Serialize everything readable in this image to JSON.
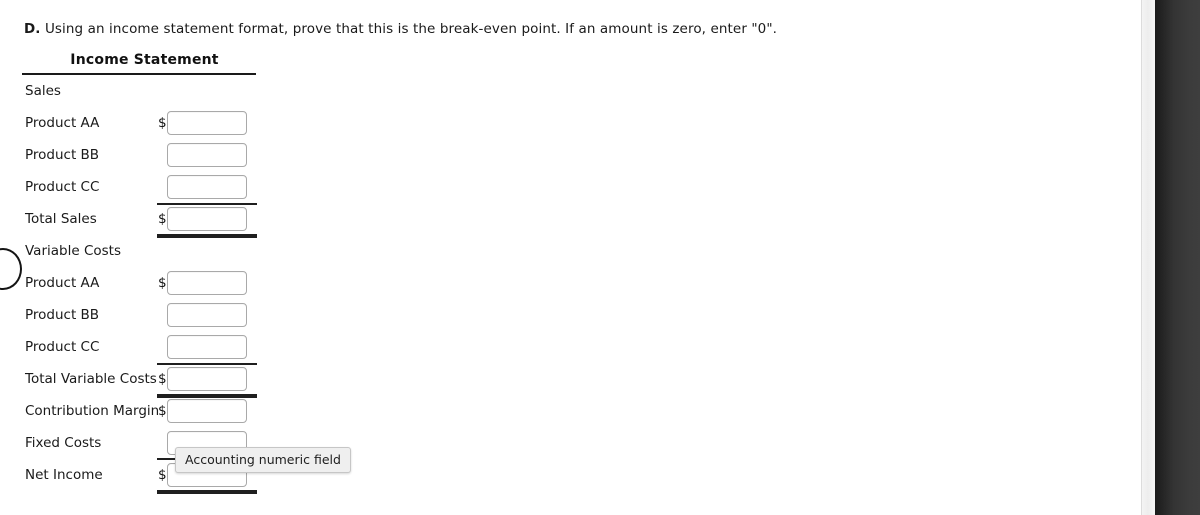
{
  "instruction": {
    "lead": "D.",
    "text": " Using an income statement format, prove that this is the break-even point. If an amount is zero, enter \"0\"."
  },
  "statement": {
    "title": "Income Statement",
    "currency_symbol": "$",
    "rows": [
      {
        "label": "Sales",
        "type": "section",
        "money": "",
        "value": "",
        "rule_top": false,
        "rule_bottom": "none"
      },
      {
        "label": "Product AA",
        "type": "input",
        "money": "$",
        "value": "",
        "rule_top": false,
        "rule_bottom": "none"
      },
      {
        "label": "Product BB",
        "type": "input",
        "money": "",
        "value": "",
        "rule_top": false,
        "rule_bottom": "none"
      },
      {
        "label": "Product CC",
        "type": "input",
        "money": "",
        "value": "",
        "rule_top": false,
        "rule_bottom": "none"
      },
      {
        "label": "Total Sales",
        "type": "input",
        "money": "$",
        "value": "",
        "rule_top": true,
        "rule_bottom": "double"
      },
      {
        "label": "Variable Costs",
        "type": "section",
        "money": "",
        "value": "",
        "rule_top": false,
        "rule_bottom": "none"
      },
      {
        "label": "Product AA",
        "type": "input",
        "money": "$",
        "value": "",
        "rule_top": false,
        "rule_bottom": "none"
      },
      {
        "label": "Product BB",
        "type": "input",
        "money": "",
        "value": "",
        "rule_top": false,
        "rule_bottom": "none"
      },
      {
        "label": "Product CC",
        "type": "input",
        "money": "",
        "value": "",
        "rule_top": false,
        "rule_bottom": "none"
      },
      {
        "label": "Total Variable Costs",
        "type": "input",
        "money": "$",
        "value": "",
        "rule_top": true,
        "rule_bottom": "double"
      },
      {
        "label": "Contribution Margin",
        "type": "input",
        "money": "$",
        "value": "",
        "rule_top": false,
        "rule_bottom": "none"
      },
      {
        "label": "Fixed Costs",
        "type": "input",
        "money": "",
        "value": "",
        "rule_top": false,
        "rule_bottom": "single"
      },
      {
        "label": "Net Income",
        "type": "input",
        "money": "$",
        "value": "",
        "rule_top": false,
        "rule_bottom": "double"
      }
    ]
  },
  "tooltip": {
    "text": "Accounting numeric field"
  }
}
